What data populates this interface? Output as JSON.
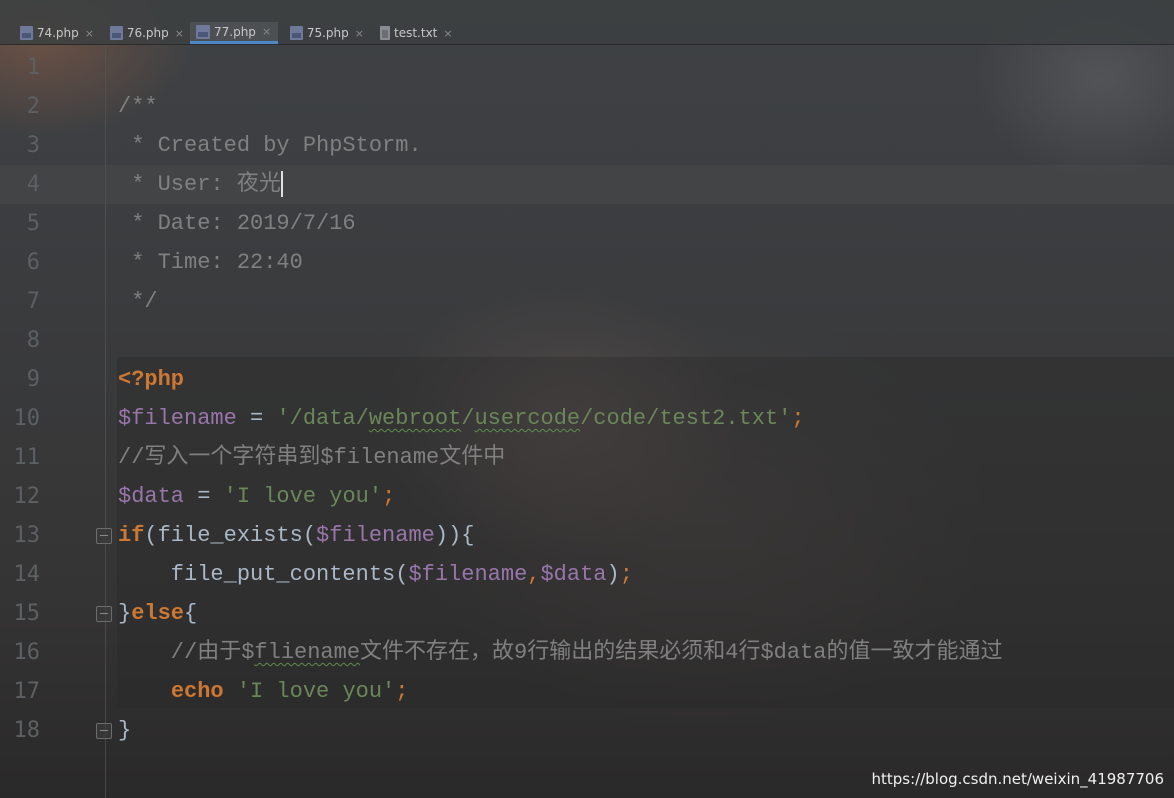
{
  "tabs": [
    {
      "label": "74.php",
      "type": "php",
      "active": false
    },
    {
      "label": "76.php",
      "type": "php",
      "active": false
    },
    {
      "label": "77.php",
      "type": "php",
      "active": true
    },
    {
      "label": "75.php",
      "type": "php",
      "active": false
    },
    {
      "label": "test.txt",
      "type": "txt",
      "active": false
    }
  ],
  "tab_close_glyph": "×",
  "colors": {
    "comment": "#808080",
    "keyword": "#cc7832",
    "variable": "#9876aa",
    "string": "#6a8759",
    "default": "#a9b7c6",
    "active_tab_underline": "#4a88c7"
  },
  "editor": {
    "line_numbers": [
      "1",
      "2",
      "3",
      "4",
      "5",
      "6",
      "7",
      "8",
      "9",
      "10",
      "11",
      "12",
      "13",
      "14",
      "15",
      "16",
      "17",
      "18"
    ],
    "caret_line": 4,
    "lines": {
      "l2": "/**",
      "l3": " * Created by PhpStorm.",
      "l4": " * User: 夜光",
      "l5": " * Date: 2019/7/16",
      "l6": " * Time: 22:40",
      "l7": " */",
      "l9": "<?php",
      "l10_var": "$filename",
      "l10_eq": " = ",
      "l10_str_a": "'/data/",
      "l10_str_b": "webroot",
      "l10_str_c": "/",
      "l10_str_d": "usercode",
      "l10_str_e": "/code/test2.txt'",
      "l10_semi": ";",
      "l11": "//写入一个字符串到$filename文件中",
      "l12_var": "$data",
      "l12_eq": " = ",
      "l12_str": "'I love you'",
      "l12_semi": ";",
      "l13_kw": "if",
      "l13_a": "(file_exists(",
      "l13_var": "$filename",
      "l13_b": ")){",
      "l14_a": "    file_put_contents(",
      "l14_var1": "$filename",
      "l14_comma": ",",
      "l14_var2": "$data",
      "l14_b": ")",
      "l14_semi": ";",
      "l15_a": "}",
      "l15_kw": "else",
      "l15_b": "{",
      "l16_a": "    //由于$",
      "l16_b": "fliename",
      "l16_c": "文件不存在，故9行输出的结果必须和4行$data的值一致才能通过",
      "l17_indent": "    ",
      "l17_kw": "echo",
      "l17_sp": " ",
      "l17_str": "'I love you'",
      "l17_semi": ";",
      "l18": "}"
    }
  },
  "watermark": "https://blog.csdn.net/weixin_41987706"
}
